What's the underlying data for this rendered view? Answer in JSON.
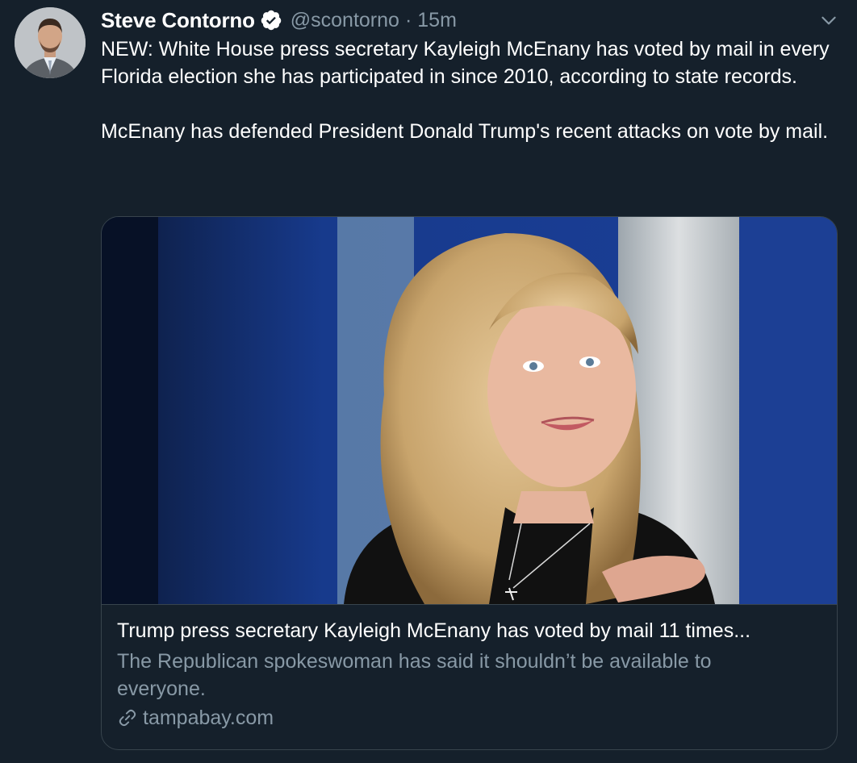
{
  "tweet": {
    "author": {
      "display_name": "Steve Contorno",
      "handle": "@scontorno",
      "verified": true,
      "avatar_icon": "user-photo"
    },
    "separator": "·",
    "timestamp": "15m",
    "text": {
      "paragraph_1": "NEW: White House press secretary Kayleigh McEnany has voted by mail in every Florida election she has participated in since 2010, according to state records.",
      "paragraph_2": "McEnany has defended President Donald Trump's recent attacks on vote by mail."
    },
    "card": {
      "title": "Trump press secretary Kayleigh McEnany has voted by mail 11 times...",
      "description": "The Republican spokeswoman has said it shouldn’t be available to everyone.",
      "domain": "tampabay.com",
      "image_icon": "article-photo"
    }
  },
  "colors": {
    "background": "#15202b",
    "primary_text": "#ffffff",
    "secondary_text": "#8899a6",
    "border": "#38444d"
  }
}
